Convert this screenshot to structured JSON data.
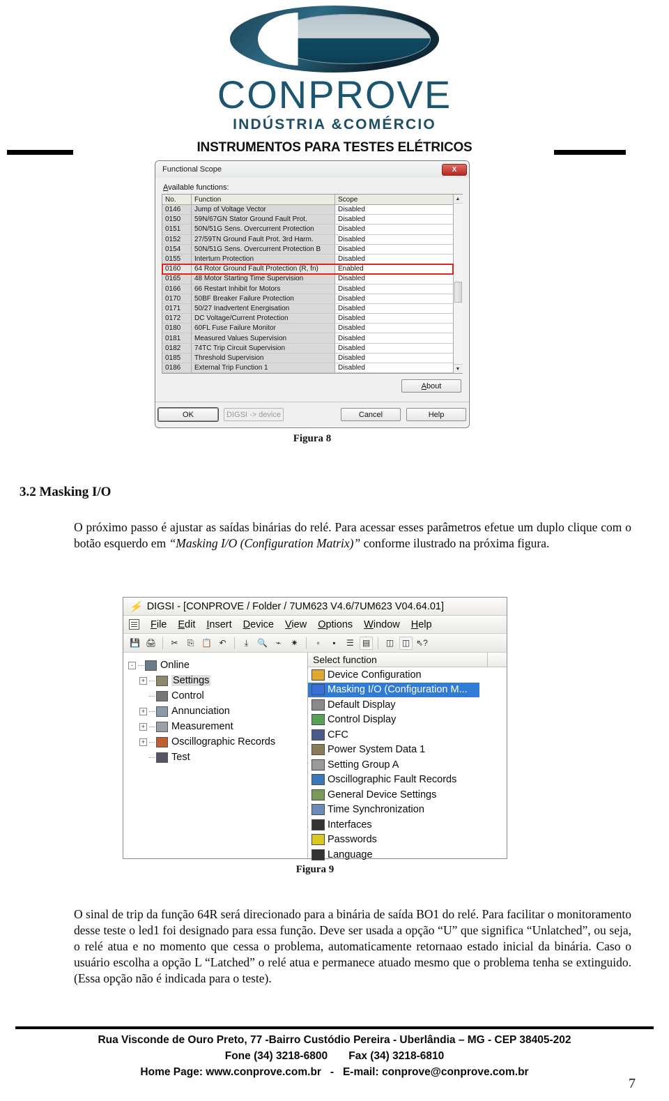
{
  "logo": {
    "name": "CONPROVE",
    "tagline": "INDÚSTRIA &COMÉRCIO"
  },
  "header": {
    "title": "INSTRUMENTOS PARA TESTES ELÉTRICOS"
  },
  "figure8": {
    "caption": "Figura 8",
    "dialog": {
      "title": "Functional Scope",
      "close_label": "X",
      "list_label": "Available functions:",
      "columns": [
        "No.",
        "Function",
        "Scope"
      ],
      "rows": [
        {
          "no": "0146",
          "function": "Jump of Voltage Vector",
          "scope": "Disabled",
          "highlighted": false
        },
        {
          "no": "0150",
          "function": "59N/67GN Stator Ground Fault Prot.",
          "scope": "Disabled",
          "highlighted": false
        },
        {
          "no": "0151",
          "function": "50N/51G Sens. Overcurrent Protection",
          "scope": "Disabled",
          "highlighted": false
        },
        {
          "no": "0152",
          "function": "27/59TN Ground Fault Prot. 3rd Harm.",
          "scope": "Disabled",
          "highlighted": false
        },
        {
          "no": "0154",
          "function": "50N/51G Sens. Overcurrent Protection B",
          "scope": "Disabled",
          "highlighted": false
        },
        {
          "no": "0155",
          "function": "Interturn Protection",
          "scope": "Disabled",
          "highlighted": false
        },
        {
          "no": "0160",
          "function": "64 Rotor Ground Fault Protection (R, fn)",
          "scope": "Enabled",
          "highlighted": true
        },
        {
          "no": "0165",
          "function": "48 Motor Starting Time Supervision",
          "scope": "Disabled",
          "highlighted": false
        },
        {
          "no": "0166",
          "function": "66 Restart Inhibit for Motors",
          "scope": "Disabled",
          "highlighted": false
        },
        {
          "no": "0170",
          "function": "50BF Breaker Failure Protection",
          "scope": "Disabled",
          "highlighted": false
        },
        {
          "no": "0171",
          "function": "50/27 Inadvertent Energisation",
          "scope": "Disabled",
          "highlighted": false
        },
        {
          "no": "0172",
          "function": "DC Voltage/Current Protection",
          "scope": "Disabled",
          "highlighted": false
        },
        {
          "no": "0180",
          "function": "60FL Fuse Failure Monitor",
          "scope": "Disabled",
          "highlighted": false
        },
        {
          "no": "0181",
          "function": "Measured Values Supervision",
          "scope": "Disabled",
          "highlighted": false
        },
        {
          "no": "0182",
          "function": "74TC Trip Circuit Supervision",
          "scope": "Disabled",
          "highlighted": false
        },
        {
          "no": "0185",
          "function": "Threshold Supervision",
          "scope": "Disabled",
          "highlighted": false
        },
        {
          "no": "0186",
          "function": "External Trip Function 1",
          "scope": "Disabled",
          "highlighted": false
        }
      ],
      "buttons": {
        "about": "About",
        "ok": "OK",
        "digsi_device": "DIGSI -> device",
        "cancel": "Cancel",
        "help": "Help"
      },
      "highlight_color": "#e2231a"
    }
  },
  "section": {
    "heading": "3.2 Masking I/O",
    "paragraph1_a": "O próximo passo é ajustar as saídas binárias do relé. Para acessar esses parâmetros efetue um duplo clique com o botão esquerdo em ",
    "paragraph1_em": "“Masking I/O (Configuration Matrix)”",
    "paragraph1_b": " conforme ilustrado na próxima figura."
  },
  "figure9": {
    "caption": "Figura 9",
    "window": {
      "title": "DIGSI - [CONPROVE / Folder / 7UM623 V4.6/7UM623 V04.64.01]",
      "menu": [
        "File",
        "Edit",
        "Insert",
        "Device",
        "View",
        "Options",
        "Window",
        "Help"
      ],
      "toolbar_icons": [
        "save-icon",
        "print-icon",
        "cut-icon",
        "copy-icon",
        "paste-icon",
        "undo-icon",
        "download-device-icon",
        "open-device-icon",
        "initialize-icon",
        "reset-icon",
        "large-icons-icon",
        "small-icons-icon",
        "list-icon",
        "details-icon",
        "device-open-icon",
        "device-close-icon",
        "help-pointer-icon"
      ],
      "tree": [
        {
          "label": "Online",
          "expander": "-",
          "icon": "device-icon",
          "depth": 0,
          "selected": false
        },
        {
          "label": "Settings",
          "expander": "+",
          "icon": "settings-icon",
          "depth": 1,
          "selected": true
        },
        {
          "label": "Control",
          "expander": "",
          "icon": "control-icon",
          "depth": 1,
          "selected": false
        },
        {
          "label": "Annunciation",
          "expander": "+",
          "icon": "annunciation-icon",
          "depth": 1,
          "selected": false
        },
        {
          "label": "Measurement",
          "expander": "+",
          "icon": "measurement-icon",
          "depth": 1,
          "selected": false
        },
        {
          "label": "Oscillographic Records",
          "expander": "+",
          "icon": "oscillographic-icon",
          "depth": 1,
          "selected": false
        },
        {
          "label": "Test",
          "expander": "",
          "icon": "test-icon",
          "depth": 1,
          "selected": false
        }
      ],
      "list_header": "Select function",
      "list_items": [
        {
          "label": "Device Configuration",
          "icon": "device-configuration-icon",
          "selected": false
        },
        {
          "label": "Masking I/O (Configuration M...",
          "icon": "masking-io-icon",
          "selected": true
        },
        {
          "label": "Default Display",
          "icon": "default-display-icon",
          "selected": false
        },
        {
          "label": "Control Display",
          "icon": "control-display-icon",
          "selected": false
        },
        {
          "label": "CFC",
          "icon": "cfc-icon",
          "selected": false
        },
        {
          "label": "Power System Data 1",
          "icon": "power-system-data-icon",
          "selected": false
        },
        {
          "label": "Setting Group A",
          "icon": "setting-group-icon",
          "selected": false
        },
        {
          "label": "Oscillographic Fault Records",
          "icon": "oscillographic-fault-icon",
          "selected": false
        },
        {
          "label": "General Device Settings",
          "icon": "general-device-settings-icon",
          "selected": false
        },
        {
          "label": "Time Synchronization",
          "icon": "time-sync-icon",
          "selected": false
        },
        {
          "label": "Interfaces",
          "icon": "interfaces-icon",
          "selected": false
        },
        {
          "label": "Passwords",
          "icon": "passwords-key-icon",
          "selected": false
        },
        {
          "label": "Language",
          "icon": "language-abc-icon",
          "selected": false
        }
      ],
      "selection_color": "#2f7bd6"
    }
  },
  "body2": {
    "line1": "O sinal de trip da função 64R será direcionado para a binária de saída BO1 do relé.",
    "line2": "Para facilitar o monitoramento desse teste o led1 foi designado para essa função.",
    "line3": "Deve ser usada a opção “U” que significa “Unlatched”, ou seja, o relé atua e no",
    "line4": "momento que cessa o problema, automaticamente retornaao estado inicial da binária.",
    "line5": "Caso o usuário escolha a opção L “Latched” o relé atua e permanece atuado mesmo",
    "line6": "que o problema tenha se extinguido. (Essa opção não é indicada para o teste)."
  },
  "footer": {
    "line1": "Rua Visconde de Ouro Preto, 77 -Bairro Custódio Pereira - Uberlândia – MG -  CEP 38405-202",
    "line2_phone": "Fone (34) 3218-6800",
    "line2_fax": "Fax (34) 3218-6810",
    "line3_home": "Home Page: www.conprove.com.br",
    "line3_dash": "-",
    "line3_email": "E-mail: conprove@conprove.com.br",
    "page_number": "7"
  }
}
